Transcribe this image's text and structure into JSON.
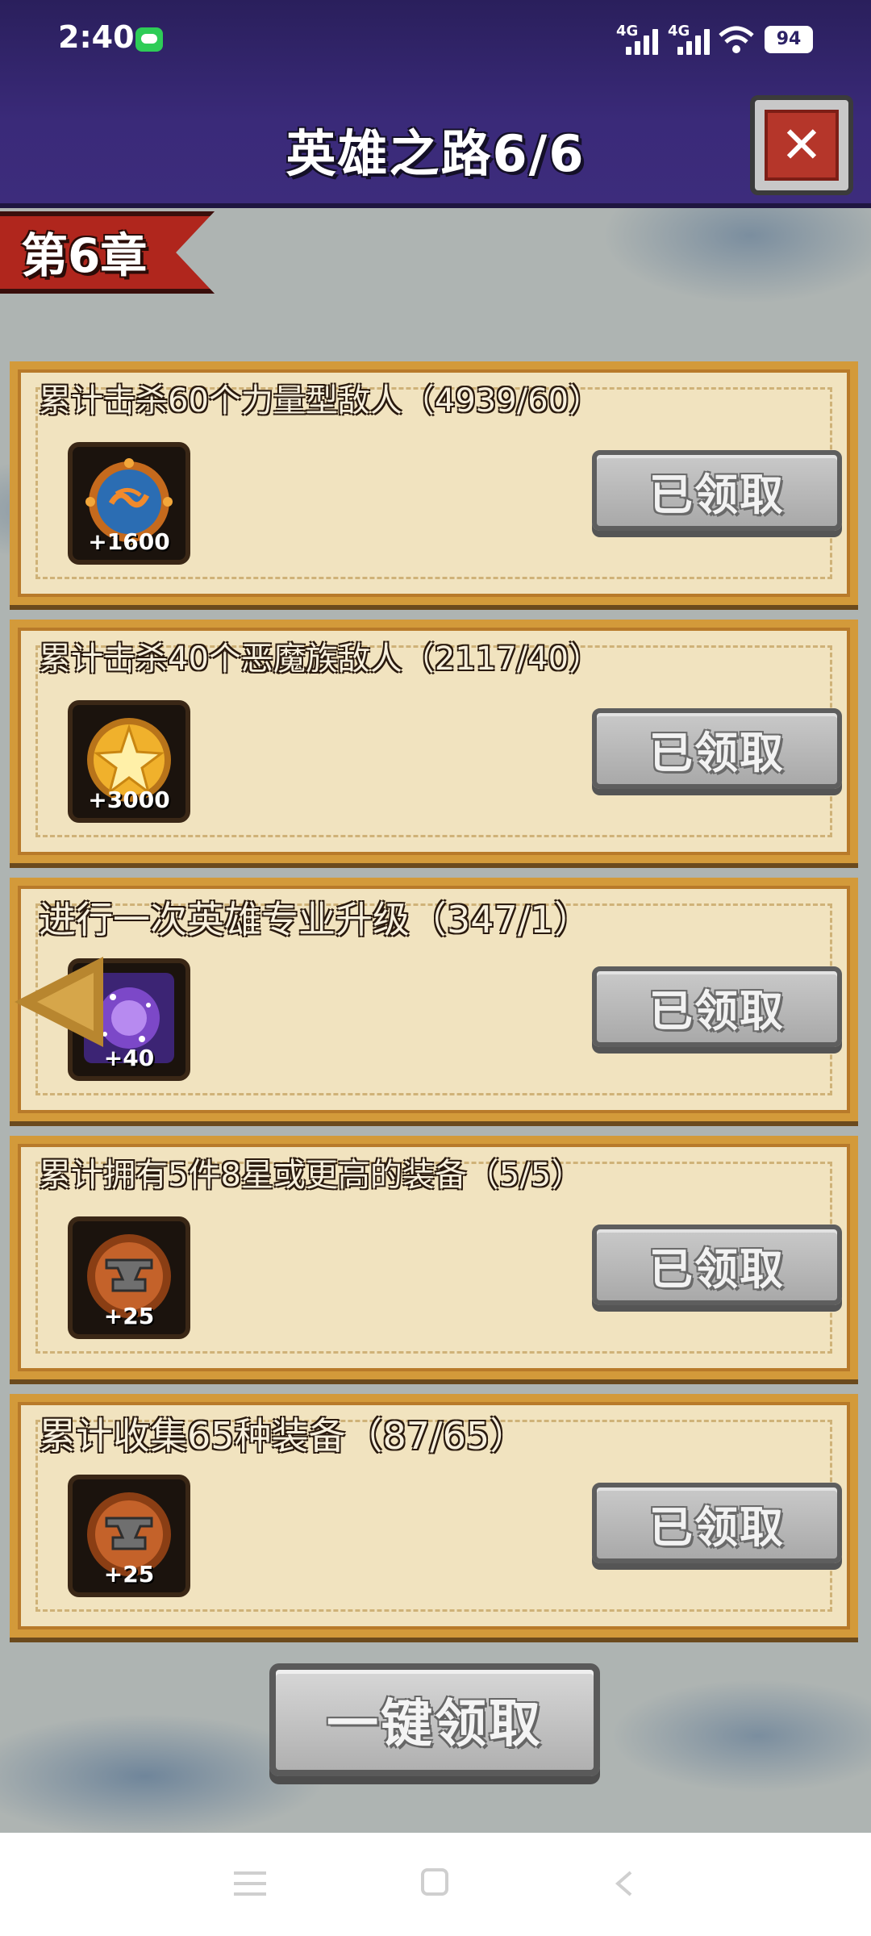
{
  "status_bar": {
    "time": "2:40",
    "network_1": "4G",
    "network_2": "4G",
    "battery": "94"
  },
  "header": {
    "title": "英雄之路6/6",
    "close_glyph": "✕"
  },
  "chapter": {
    "label": "第6章"
  },
  "quests": [
    {
      "title": "累计击杀60个力量型敌人（4939/60）",
      "reward_icon": "orb-icon",
      "reward_amount": "+1600",
      "button_label": "已领取"
    },
    {
      "title": "累计击杀40个恶魔族敌人（2117/40）",
      "reward_icon": "gold-coin-icon",
      "reward_amount": "+3000",
      "button_label": "已领取"
    },
    {
      "title": "进行一次英雄专业升级（347/1）",
      "reward_icon": "galaxy-gem-icon",
      "reward_amount": "+40",
      "button_label": "已领取"
    },
    {
      "title": "累计拥有5件8星或更高的装备（5/5）",
      "reward_icon": "anvil-icon",
      "reward_amount": "+25",
      "button_label": "已领取"
    },
    {
      "title": "累计收集65种装备（87/65）",
      "reward_icon": "anvil-icon",
      "reward_amount": "+25",
      "button_label": "已领取"
    }
  ],
  "footer": {
    "claim_all_label": "一键领取"
  },
  "colors": {
    "header_purple": "#3a2a79",
    "card_parchment": "#f1e3bf",
    "card_border": "#d39a3a",
    "ribbon_red": "#b0261d",
    "button_gray": "#b9b9b9"
  }
}
